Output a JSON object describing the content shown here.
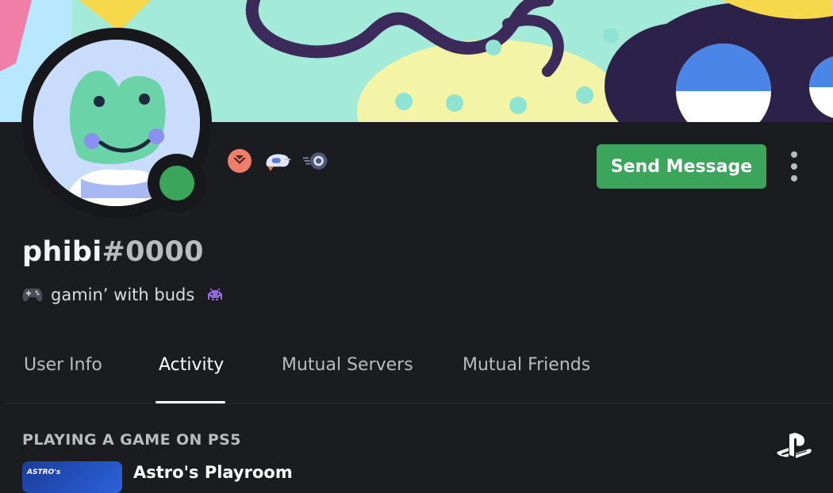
{
  "profile": {
    "username": "phibi",
    "discriminator": "#0000",
    "status_text": "gamin’ with buds",
    "status_emoji_left": "controller-icon",
    "status_emoji_right": "space-invader-icon",
    "online_status": "online",
    "badges": [
      "hypesquad-brilliance-badge-icon",
      "nitro-badge-icon",
      "server-boost-badge-icon"
    ]
  },
  "actions": {
    "send_message_label": "Send Message",
    "more_options_icon": "kebab-menu-icon"
  },
  "tabs": [
    {
      "label": "User Info",
      "active": false
    },
    {
      "label": "Activity",
      "active": true
    },
    {
      "label": "Mutual Servers",
      "active": false
    },
    {
      "label": "Mutual Friends",
      "active": false
    }
  ],
  "activity": {
    "section_title": "PLAYING A GAME ON PS5",
    "platform_icon": "playstation-icon",
    "game_title": "Astro's Playroom",
    "thumb_text": "ASTRO's"
  },
  "colors": {
    "background": "#1b1c20",
    "accent_green": "#3ba55c",
    "muted_text": "#b9bbbe"
  }
}
